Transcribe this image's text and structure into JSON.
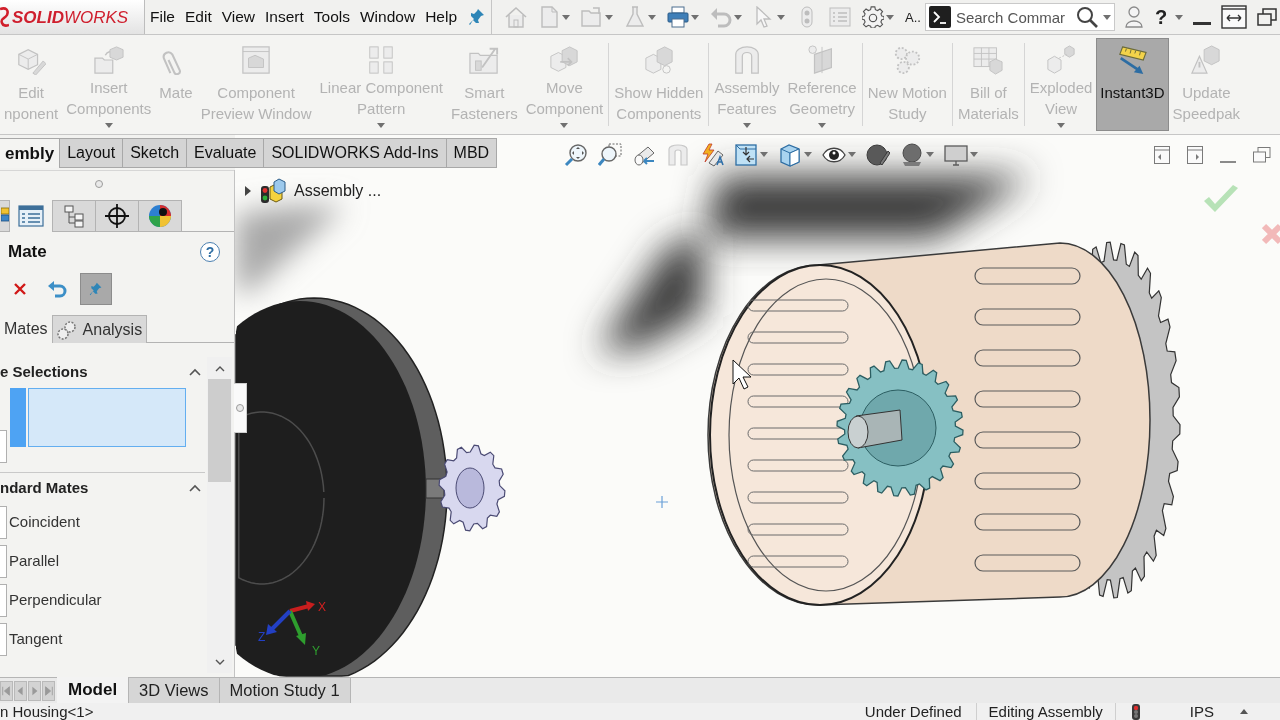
{
  "title_bar": {
    "logo": "**SOLID**WORKS",
    "menu": [
      {
        "label": "File"
      },
      {
        "label": "Edit"
      },
      {
        "label": "View"
      },
      {
        "label": "Insert"
      },
      {
        "label": "Tools"
      },
      {
        "label": "Window"
      },
      {
        "label": "Help"
      }
    ],
    "options_label": "A..",
    "search": {
      "placeholder": "Search Commar"
    },
    "help_label": "?"
  },
  "command_manager": {
    "buttons": [
      {
        "label": "Edit\nnponent",
        "dropdown": false,
        "disabled": true,
        "selected": false,
        "separator_before": false
      },
      {
        "label": "Insert\nComponents",
        "dropdown": true,
        "disabled": true,
        "selected": false,
        "separator_before": false
      },
      {
        "label": "Mate",
        "dropdown": false,
        "disabled": true,
        "selected": false,
        "separator_before": false
      },
      {
        "label": "Component\nPreview Window",
        "dropdown": false,
        "disabled": true,
        "selected": false,
        "separator_before": false
      },
      {
        "label": "Linear Component\nPattern",
        "dropdown": true,
        "disabled": true,
        "selected": false,
        "separator_before": false
      },
      {
        "label": "Smart\nFasteners",
        "dropdown": false,
        "disabled": true,
        "selected": false,
        "separator_before": false
      },
      {
        "label": "Move\nComponent",
        "dropdown": true,
        "disabled": true,
        "selected": false,
        "separator_before": false
      },
      {
        "label": "Show Hidden\nComponents",
        "dropdown": false,
        "disabled": true,
        "selected": false,
        "separator_before": true
      },
      {
        "label": "Assembly\nFeatures",
        "dropdown": true,
        "disabled": true,
        "selected": false,
        "separator_before": true
      },
      {
        "label": "Reference\nGeometry",
        "dropdown": true,
        "disabled": true,
        "selected": false,
        "separator_before": false
      },
      {
        "label": "New Motion\nStudy",
        "dropdown": false,
        "disabled": true,
        "selected": false,
        "separator_before": true
      },
      {
        "label": "Bill of\nMaterials",
        "dropdown": false,
        "disabled": true,
        "selected": false,
        "separator_before": true
      },
      {
        "label": "Exploded\nView",
        "dropdown": true,
        "disabled": true,
        "selected": false,
        "separator_before": true
      },
      {
        "label": "Instant3D",
        "dropdown": false,
        "disabled": false,
        "selected": true,
        "separator_before": false
      },
      {
        "label": "Update\nSpeedpak",
        "dropdown": false,
        "disabled": true,
        "selected": false,
        "separator_before": false
      }
    ]
  },
  "command_tabs": [
    {
      "label": "embly",
      "selected": true
    },
    {
      "label": "Layout",
      "selected": false
    },
    {
      "label": "Sketch",
      "selected": false
    },
    {
      "label": "Evaluate",
      "selected": false
    },
    {
      "label": "SOLIDWORKS Add-Ins",
      "selected": false
    },
    {
      "label": "MBD",
      "selected": false
    }
  ],
  "feature_tree": {
    "label": "Assembly ...",
    "expanded": false
  },
  "viewport": {
    "triad_labels": [
      {
        "label": "X"
      },
      {
        "label": "Y"
      },
      {
        "label": "Z"
      }
    ]
  },
  "property_manager": {
    "tabs": [
      {
        "selected": false
      },
      {
        "selected": true
      },
      {
        "selected": false
      },
      {
        "selected": false
      },
      {
        "selected": false
      }
    ],
    "title": "Mate",
    "help_label": "?",
    "pin_pressed": true,
    "subtabs": [
      {
        "label": "Mates",
        "selected": true
      },
      {
        "label": "Analysis",
        "selected": false
      }
    ],
    "selections": {
      "title": "e Selections",
      "expanded": true
    },
    "standard_mates": {
      "title": "ndard Mates",
      "expanded": true,
      "items": [
        {
          "label": "Coincident"
        },
        {
          "label": "Parallel"
        },
        {
          "label": "Perpendicular"
        },
        {
          "label": "Tangent"
        }
      ]
    }
  },
  "model_tabs": [
    {
      "label": "Model",
      "selected": true
    },
    {
      "label": "3D Views",
      "selected": false
    },
    {
      "label": "Motion Study 1",
      "selected": false
    }
  ],
  "status_bar": {
    "component": "n Housing<1>",
    "state": "Under Defined",
    "mode": "Editing Assembly",
    "units": "IPS"
  }
}
